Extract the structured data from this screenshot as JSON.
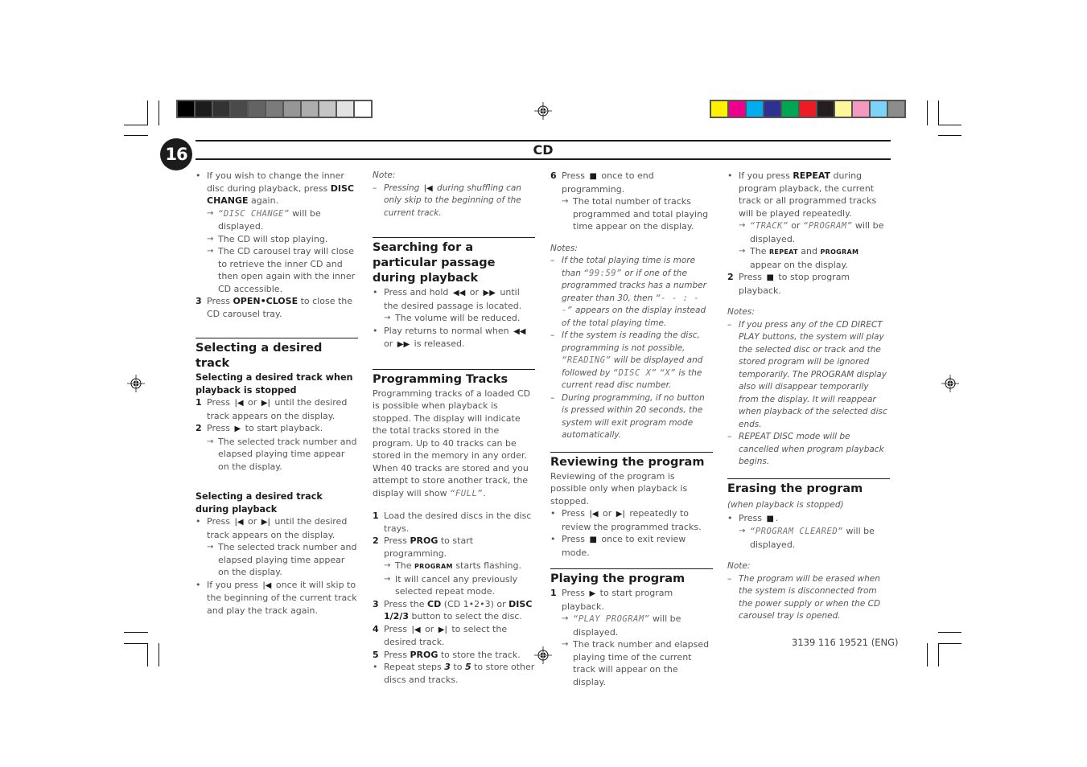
{
  "header": {
    "page_number": "16",
    "section_title": "CD"
  },
  "colors": {
    "grayscale_swatches": [
      "#000000",
      "#1c1c1c",
      "#333333",
      "#4a4a4a",
      "#636363",
      "#7b7b7b",
      "#969696",
      "#adadad",
      "#c5c5c5",
      "#e2e2e2",
      "#ffffff"
    ],
    "color_swatches": [
      "#fff200",
      "#ec008c",
      "#00aeef",
      "#2e3192",
      "#00a651",
      "#ed1c24",
      "#231f20",
      "#fff799",
      "#f49ac1",
      "#7dd3f7",
      "#8c8c8c"
    ],
    "text_dark": "#1c1c1c",
    "text_body": "#555555"
  },
  "icons": {
    "prev": "⏮",
    "next": "⏭",
    "play": "▶",
    "stop": "■",
    "rew": "◀◀",
    "ffwd": "▶▶",
    "arrow": "→",
    "bullet": "•",
    "dash": "–"
  },
  "col1": {
    "bullet1": {
      "pre": "If you wish to change the inner disc during playback, press ",
      "bold": "DISC CHANGE",
      "post": " again."
    },
    "arrows1": [
      {
        "lcd": "“DISC CHANGE”",
        "post": " will be displayed."
      },
      {
        "text": "The CD will stop playing."
      },
      {
        "text": "The CD carousel tray will close to retrieve the inner CD and then open again with the inner CD accessible."
      }
    ],
    "step3": {
      "num": "3",
      "pre": "Press ",
      "bold": "OPEN•CLOSE",
      "post": " to close the CD carousel tray."
    },
    "sec_select": {
      "title": "Selecting a desired track",
      "sub1": "Selecting a desired track when playback is stopped",
      "s1": {
        "num": "1",
        "pre": "Press ",
        "mid": " or ",
        "post": " until the desired track appears on the display."
      },
      "s2": {
        "num": "2",
        "pre": "Press ",
        "post": " to start playback."
      },
      "s2_arrow": "The selected track number and elapsed playing time appear on the display.",
      "sub2": "Selecting a desired track during playback",
      "b1": {
        "pre": "Press ",
        "mid": " or ",
        "post": " until the desired track appears on the display."
      },
      "b1_arrow": "The selected track number and elapsed playing time appear on the display.",
      "b2": {
        "pre": "If you press ",
        "post": " once it will skip to the beginning of the current track and play the track again."
      }
    }
  },
  "col2": {
    "note_label": "Note:",
    "note1": {
      "pre": "Pressing ",
      "post": " during shuffling can only skip to the beginning of the current track."
    },
    "sec_search": {
      "title": "Searching for a particular passage during playback",
      "b1": {
        "pre": "Press and hold ",
        "mid": " or ",
        "post": " until the desired passage is located."
      },
      "b1_arrow": "The volume will be reduced.",
      "b2": {
        "pre": "Play returns to normal when ",
        "mid": " or ",
        "post": " is released."
      }
    },
    "sec_prog": {
      "title": "Programming Tracks",
      "intro_pre": "Programming tracks of a loaded CD is possible when playback is stopped. The display will indicate the total tracks stored in the program. Up to 40 tracks can be stored in the memory in any order. When 40 tracks are stored and you attempt to store another track, the display will show ",
      "intro_lcd": "“FULL”",
      "intro_post": ".",
      "s1": {
        "num": "1",
        "text": "Load the desired discs in the disc trays."
      },
      "s2": {
        "num": "2",
        "pre": "Press ",
        "bold": "PROG",
        "post": " to start programming."
      },
      "s2_a1": {
        "pre": "The ",
        "sc": "PROGRAM",
        "post": " starts flashing."
      },
      "s2_a2": "It will cancel any previously selected repeat mode.",
      "s3": {
        "num": "3",
        "pre": "Press the ",
        "bold1": "CD",
        "mid": " (CD 1•2•3) or ",
        "bold2": "DISC 1/2/3",
        "post": " button to select the disc."
      },
      "s4": {
        "num": "4",
        "pre": "Press ",
        "mid": " or ",
        "post": " to select the desired track."
      },
      "s5": {
        "num": "5",
        "pre": "Press ",
        "bold": "PROG",
        "post": " to store the track."
      },
      "b_repeat": {
        "pre": "Repeat steps ",
        "n1": "3",
        "mid": " to ",
        "n2": "5",
        "post": " to store other discs and tracks."
      }
    }
  },
  "col3": {
    "s6": {
      "num": "6",
      "pre": "Press ",
      "post": " once to end programming."
    },
    "s6_arrow": "The total number of tracks programmed and total playing time appear on the display.",
    "notes_label": "Notes:",
    "n1": {
      "pre": "If the total playing time is more than ",
      "lcd1": "“99:59”",
      "mid": " or if one of the programmed tracks has a number greater than 30, then ",
      "lcd2": "“- - : - -”",
      "post": " appears on the display instead of the total playing time."
    },
    "n2": {
      "pre": "If the system is reading the disc, programming is not possible, ",
      "lcd1": "“READING”",
      "mid": " will be displayed and followed by ",
      "lcd2": "“DISC X”",
      "mid2": " ",
      "lcd3": "“X”",
      "post": " is the current read disc number."
    },
    "n3": "During programming,  if no button is pressed within 20 seconds, the system will exit program mode automatically.",
    "sec_review": {
      "title": "Reviewing the program",
      "intro": "Reviewing of the program is possible only when playback is stopped.",
      "b1": {
        "pre": "Press ",
        "mid": " or ",
        "post": " repeatedly to review the programmed tracks."
      },
      "b2": {
        "pre": "Press ",
        "post": " once to exit review mode."
      }
    },
    "sec_play": {
      "title": "Playing the program",
      "s1": {
        "num": "1",
        "pre": "Press ",
        "post": " to start program playback."
      },
      "a1": {
        "lcd": "“PLAY PROGRAM”",
        "post": " will be displayed."
      },
      "a2": "The track number and elapsed playing time of the current track will appear on the display."
    }
  },
  "col4": {
    "b1": {
      "pre": "If you press ",
      "bold": "REPEAT",
      "post": " during program playback, the current track or all programmed tracks will be played repeatedly."
    },
    "a1": {
      "lcd1": "“TRACK”",
      "mid": " or ",
      "lcd2": "“PROGRAM”",
      "post": " will be displayed."
    },
    "a2": {
      "pre": "The ",
      "sc1": "REPEAT",
      "mid": " and ",
      "sc2": "PROGRAM",
      "post": " appear on the display."
    },
    "s2": {
      "num": "2",
      "pre": "Press ",
      "post": " to stop program playback."
    },
    "notes_label": "Notes:",
    "n1": "If you press any of the CD DIRECT PLAY buttons, the system will play the selected disc or track and the stored program will be ignored temporarily. The PROGRAM display also will disappear temporarily from the display. It will reappear when playback of the selected disc ends.",
    "n2": "REPEAT DISC mode will be cancelled when program playback begins.",
    "sec_erase": {
      "title": "Erasing the program",
      "title_note": "(when playback is stopped)",
      "b1": {
        "pre": "Press ",
        "post": "."
      },
      "a1": {
        "lcd": "“PROGRAM CLEARED”",
        "post": " will be displayed."
      },
      "note_label": "Note:",
      "n1": "The program will be erased when the system is disconnected from the power supply or when the CD carousel tray is opened."
    }
  },
  "footer": {
    "code": "3139 116 19521 (ENG)"
  }
}
